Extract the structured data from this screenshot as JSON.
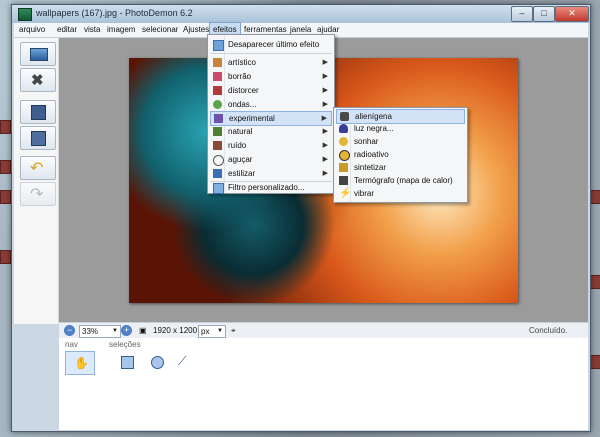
{
  "window": {
    "title": "wallpapers (167).jpg  -  PhotoDemon 6.2",
    "minimize": "–",
    "maximize": "□",
    "close": "✕"
  },
  "menubar": [
    "arquivo",
    "editar",
    "vista",
    "imagem",
    "selecionar",
    "Ajustes",
    "efeitos",
    "ferramentas",
    "janela",
    "ajudar"
  ],
  "effects_menu": {
    "top_item": "Desaparecer último efeito",
    "items": [
      {
        "label": "artístico",
        "icon": "brush-icon",
        "color": "#c9823b"
      },
      {
        "label": "borrão",
        "icon": "blur-icon",
        "color": "#c94d6a"
      },
      {
        "label": "distorcer",
        "icon": "distort-icon",
        "color": "#b33a3a"
      },
      {
        "label": "ondas...",
        "icon": "wave-icon",
        "color": "#59a34a"
      },
      {
        "label": "experimental",
        "icon": "flask-icon",
        "color": "#6c54a8"
      },
      {
        "label": "natural",
        "icon": "tree-icon",
        "color": "#4f7f2f"
      },
      {
        "label": "ruído",
        "icon": "noise-icon",
        "color": "#8a4a3a"
      },
      {
        "label": "aguçar",
        "icon": "glasses-icon",
        "color": "#555555"
      },
      {
        "label": "estilizar",
        "icon": "stylize-icon",
        "color": "#3a6fb5"
      }
    ],
    "bottom_item": "Filtro personalizado..."
  },
  "experimental_submenu": [
    {
      "label": "alienígena",
      "icon": "alien-icon",
      "color": "#4a4a4a"
    },
    {
      "label": "luz negra...",
      "icon": "bulb-icon",
      "color": "#3b3b9a"
    },
    {
      "label": "sonhar",
      "icon": "smiley-icon",
      "color": "#e2b632"
    },
    {
      "label": "radioativo",
      "icon": "radioactive-icon",
      "color": "#e2b632"
    },
    {
      "label": "sintetizar",
      "icon": "trophy-icon",
      "color": "#c89a2a"
    },
    {
      "label": "Termógrafo (mapa de calor)",
      "icon": "thermograph-icon",
      "color": "#444444"
    },
    {
      "label": "vibrar",
      "icon": "lightning-icon",
      "color": "#e0b52a"
    }
  ],
  "statusbar": {
    "zoom_out": "−",
    "zoom": "33%",
    "zoom_in": "+",
    "dimensions": "1920 x 1200",
    "unit": "px",
    "status": "Concluído."
  },
  "bottom_panel": {
    "nav_label": "nav",
    "selections_label": "seleções"
  },
  "colors": {
    "accent": "#4f7fc4",
    "highlight": "#d3e3f7"
  }
}
